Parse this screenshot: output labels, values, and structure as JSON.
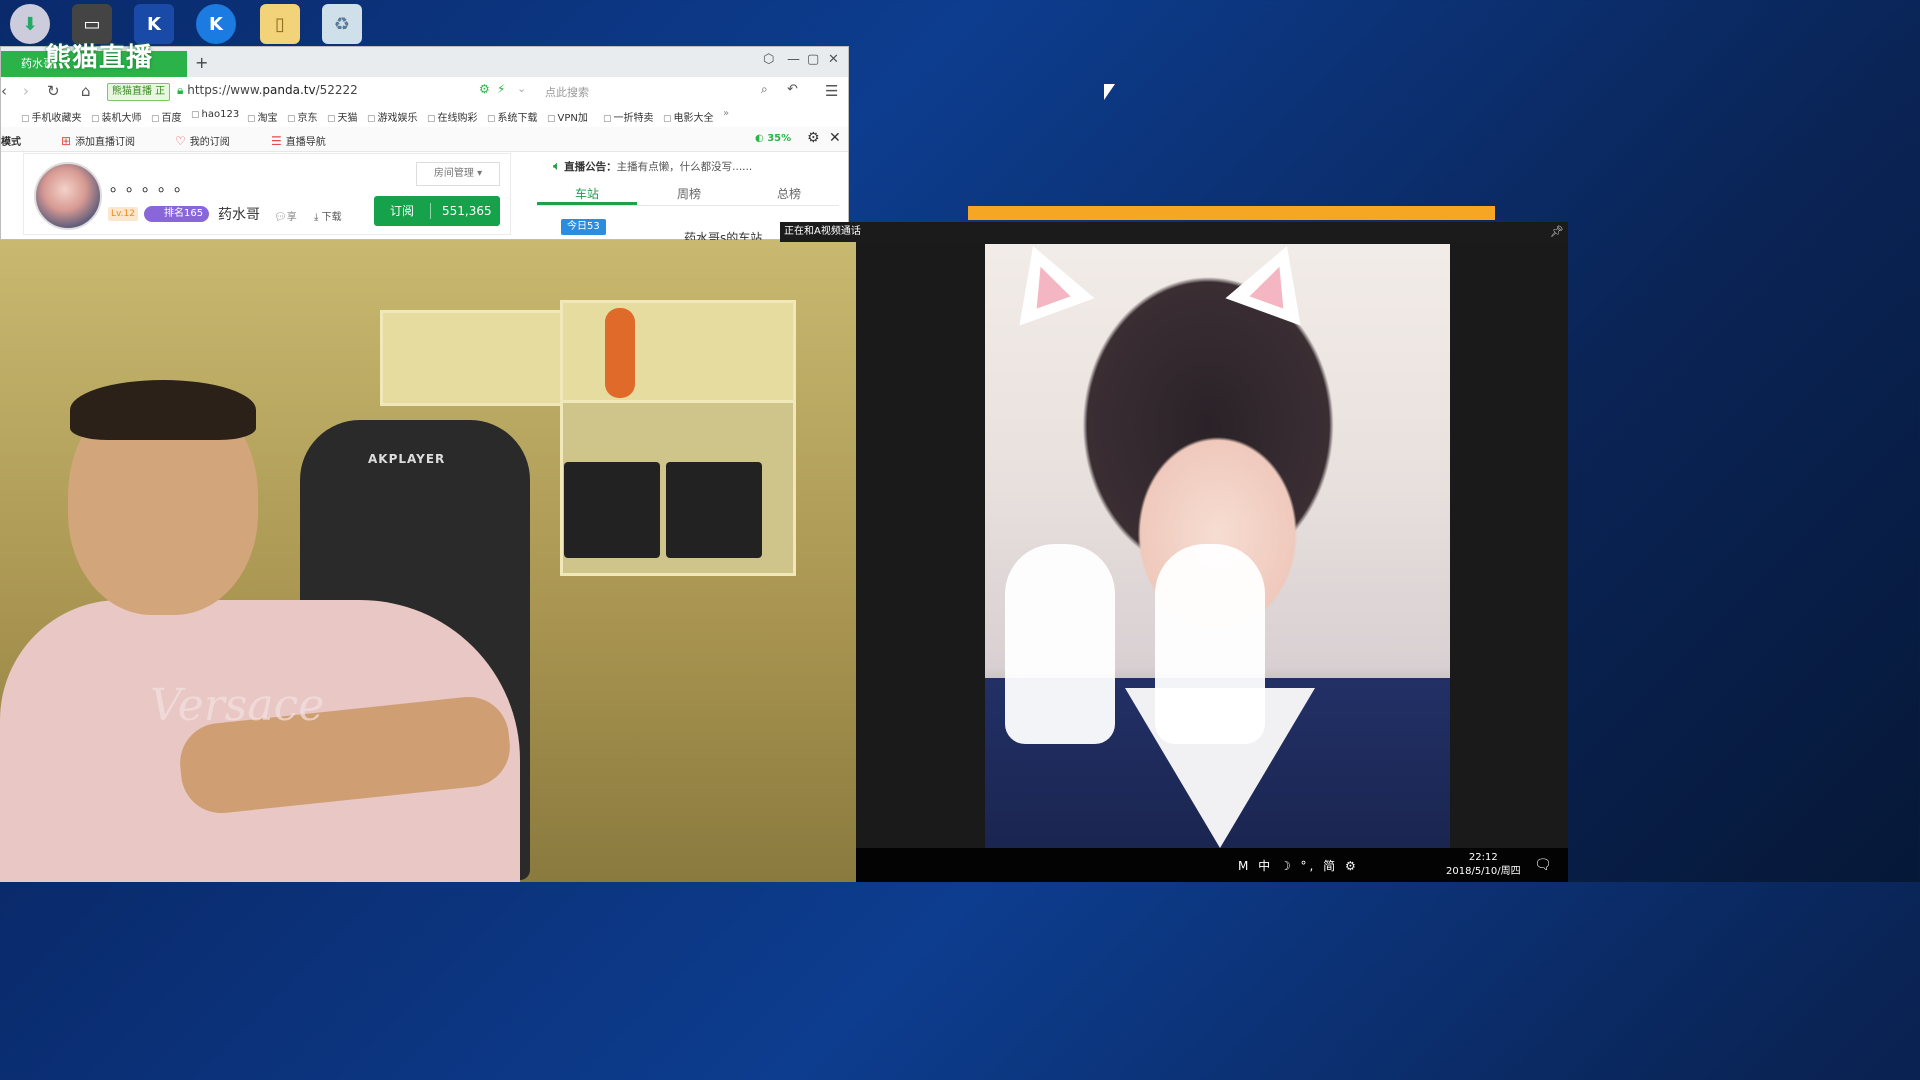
{
  "browser": {
    "tab_title": "药水哥",
    "tab_logo": "熊猫直播",
    "new_tab": "+",
    "fast_badge": "熊猫直播 正",
    "url_prefix": "https://www.",
    "url_domain": "panda.tv",
    "url_path": "/52222",
    "search_placeholder": "点此搜索",
    "bookmarks": [
      "手机收藏夹",
      "装机大师",
      "百度",
      "hao123",
      "淘宝",
      "京东",
      "天猫",
      "游戏娱乐",
      "在线购彩",
      "系统下载",
      "VPN加",
      "一折特卖",
      "电影大全"
    ],
    "bookmarks_more": "»",
    "mode_label": "模式",
    "toolbar": {
      "add_sub": "添加直播订阅",
      "my_sub": "我的订阅",
      "nav": "直播导航",
      "percent": "35%"
    }
  },
  "streamer": {
    "dots": "。。。。。",
    "level": "Lv.12",
    "rank": "排名165",
    "name": "药水哥",
    "share": "享",
    "download": "下载",
    "room_mgmt": "房间管理",
    "subscribe_label": "订阅",
    "subscribe_count": "551,365"
  },
  "side_panel": {
    "notice_label": "直播公告：",
    "notice_text": "主播有点懒，什么都没写......",
    "tabs": [
      "车站",
      "周榜",
      "总榜"
    ],
    "active_tab": 0,
    "today_badge": "今日53",
    "cut_text": "药水哥s的车站"
  },
  "video_call": {
    "title": "正在和A视频通话"
  },
  "webcam": {
    "chair_brand": "AKPLAYER",
    "shirt_text": "Versace"
  },
  "taskbar": {
    "tray_icons": "M 中 ☽ °, 简 ⚙",
    "time": "22:12",
    "date": "2018/5/10/周四"
  }
}
